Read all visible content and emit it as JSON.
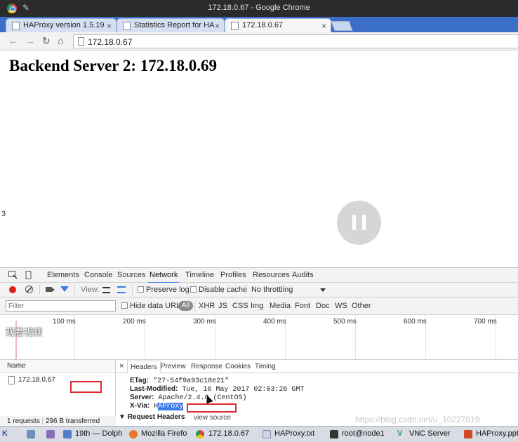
{
  "window": {
    "title": "172.18.0.67 - Google Chrome"
  },
  "tabs": [
    {
      "label": "HAProxy version 1.5.19",
      "active": false
    },
    {
      "label": "Statistics Report for HA",
      "active": false
    },
    {
      "label": "172.18.0.67",
      "active": true
    }
  ],
  "toolbar": {
    "url": "172.18.0.67"
  },
  "page": {
    "heading": "Backend Server 2: 172.18.0.69",
    "side_marker": "3"
  },
  "devtools": {
    "tabs": [
      "Elements",
      "Console",
      "Sources",
      "Network",
      "Timeline",
      "Profiles",
      "Resources",
      "Audits"
    ],
    "active_tab": "Network",
    "toolbar": {
      "view_label": "View:",
      "preserve_log": "Preserve log",
      "disable_cache": "Disable cache",
      "throttling": "No throttling"
    },
    "filter": {
      "placeholder": "Filter",
      "hide_data_urls": "Hide data URLs",
      "all": "All",
      "types": [
        "XHR",
        "JS",
        "CSS",
        "Img",
        "Media",
        "Font",
        "Doc",
        "WS",
        "Other"
      ]
    },
    "timeline": {
      "ticks": [
        "100 ms",
        "200 ms",
        "300 ms",
        "400 ms",
        "500 ms",
        "600 ms",
        "700 ms"
      ],
      "overlay_text": "观看视频"
    },
    "request_list": {
      "header": "Name",
      "rows": [
        "172.18.0.67"
      ]
    },
    "detail": {
      "tabs": [
        "Headers",
        "Preview",
        "Response",
        "Cookies",
        "Timing"
      ],
      "active_tab": "Headers",
      "close": "×",
      "headers": [
        {
          "name": "ETag:",
          "value": "\"27-54f9a93c18e21\""
        },
        {
          "name": "Last-Modified:",
          "value": "Tue, 16 May 2017 02:03:26 GMT"
        },
        {
          "name": "Server:",
          "value": "Apache/2.4.6 (CentOS)"
        },
        {
          "name": "X-Via:",
          "value_prefix": "H",
          "value_selected": "AProxy"
        }
      ],
      "request_headers": "Request Headers",
      "view_source": "view source"
    },
    "status": {
      "requests": "1 requests",
      "transferred": "296 B transferred"
    }
  },
  "taskbar": {
    "items": [
      "19th — Dolph",
      "Mozilla Firefo",
      "172.18.0.67",
      "HAProxy.txt",
      "root@node1",
      "VNC Server",
      "HAProxy.ppt"
    ]
  },
  "watermark": "https://blog.csdn.net/u_10227019"
}
